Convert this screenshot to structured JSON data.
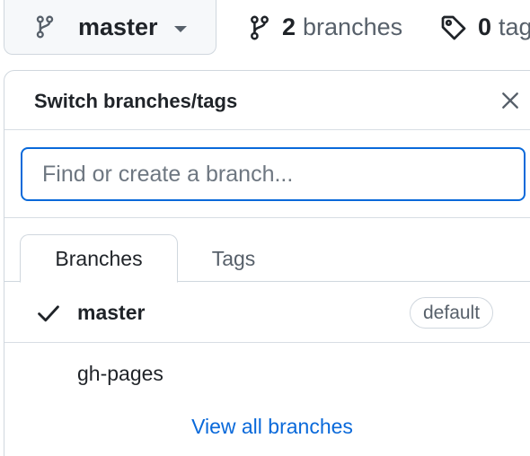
{
  "branch_button": {
    "label": "master",
    "icon": "git-branch-icon"
  },
  "stats": {
    "branches": {
      "count": "2",
      "label": "branches",
      "icon": "git-branch-icon"
    },
    "tags": {
      "count": "0",
      "label": "tags",
      "icon": "tag-icon"
    }
  },
  "dropdown": {
    "title": "Switch branches/tags",
    "search_placeholder": "Find or create a branch...",
    "tabs": [
      {
        "label": "Branches",
        "selected": true
      },
      {
        "label": "Tags",
        "selected": false
      }
    ],
    "items": [
      {
        "name": "master",
        "checked": true,
        "badge": "default"
      },
      {
        "name": "gh-pages",
        "checked": false
      }
    ],
    "view_all": "View all branches"
  },
  "colors": {
    "accent": "#0969da",
    "muted": "#57606a",
    "border": "#d0d7de"
  }
}
